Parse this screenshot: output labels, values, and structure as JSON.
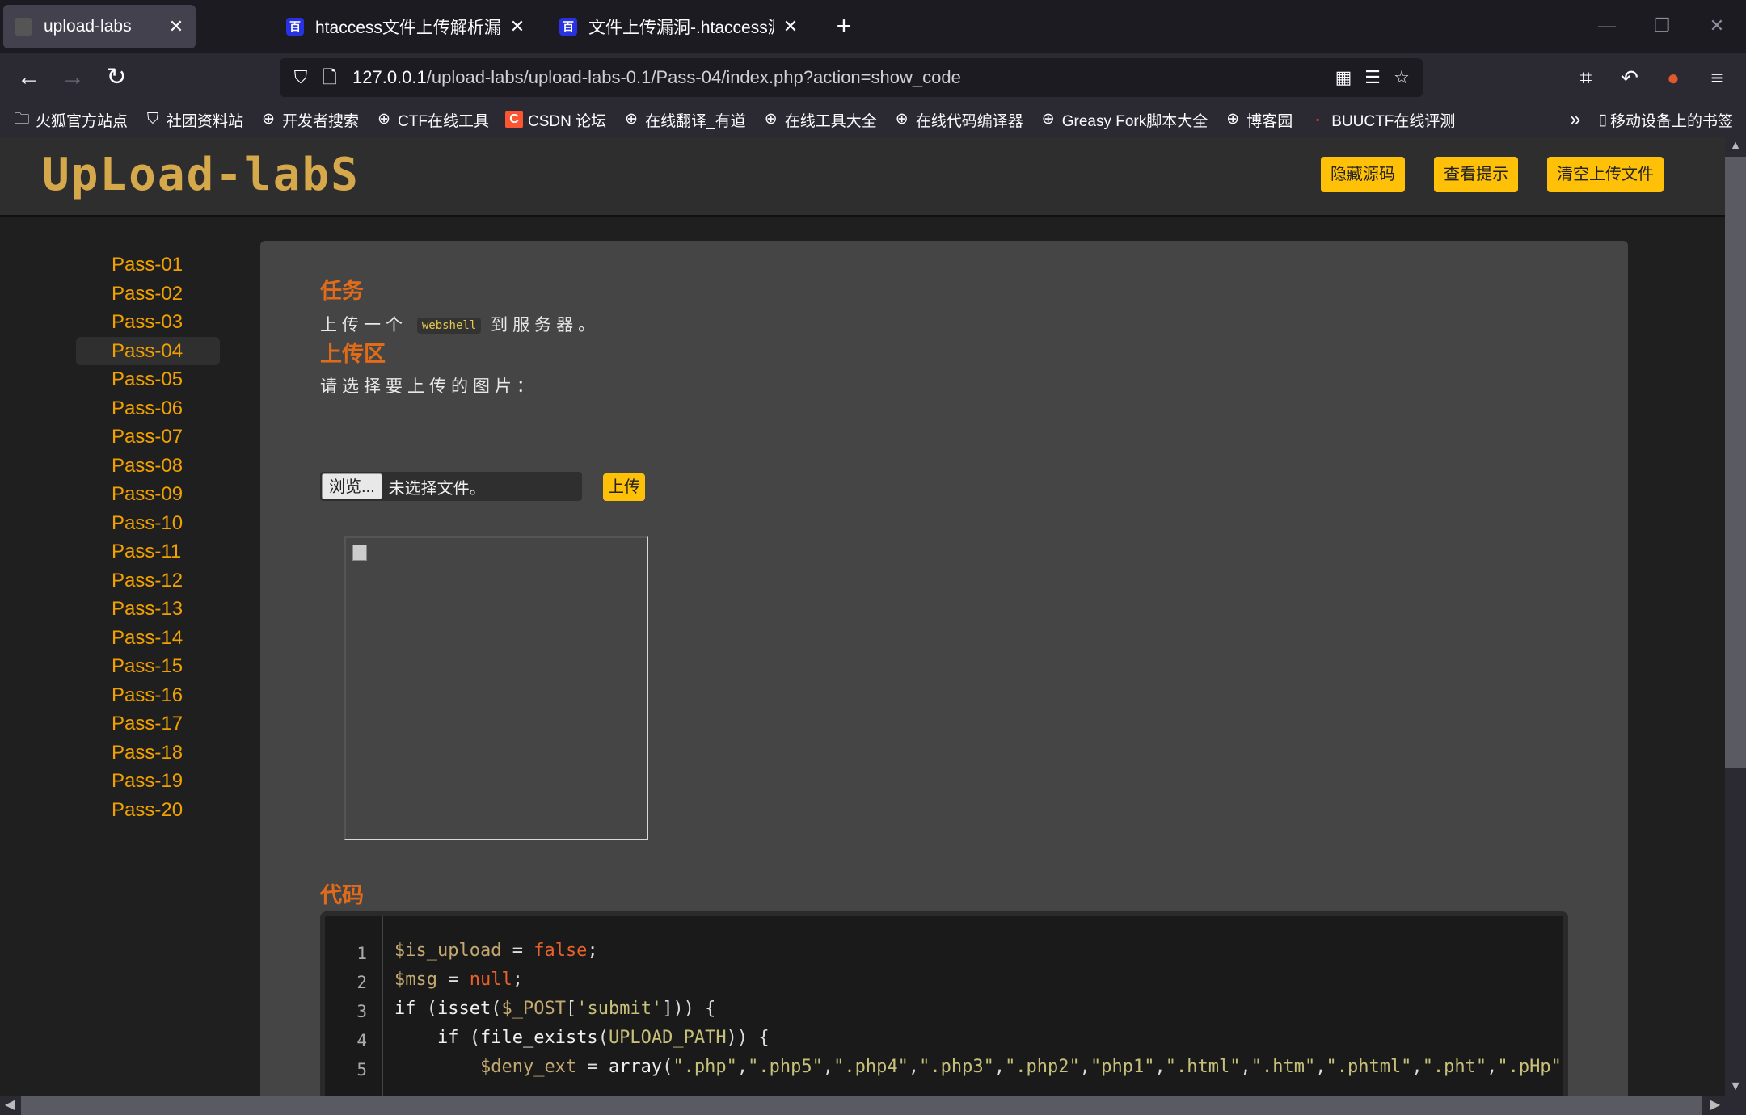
{
  "browser": {
    "tabs": [
      {
        "title": "upload-labs",
        "favicon": "dark-icon"
      },
      {
        "title": "htaccess文件上传解析漏洞_百度",
        "favicon": "baidu-icon"
      },
      {
        "title": "文件上传漏洞-.htaccess漏洞利",
        "favicon": "baidu-icon"
      }
    ],
    "new_tab": "+",
    "url_host": "127.0.0.1",
    "url_rest": "/upload-labs/upload-labs-0.1/Pass-04/index.php?action=show_code",
    "bookmarks": [
      {
        "label": "火狐官方站点",
        "icon": "folder-icon"
      },
      {
        "label": "社团资料站",
        "icon": "shield-icon"
      },
      {
        "label": "开发者搜索",
        "icon": "globe-icon"
      },
      {
        "label": "CTF在线工具",
        "icon": "globe-icon"
      },
      {
        "label": "CSDN 论坛",
        "icon": "csdn-icon"
      },
      {
        "label": "在线翻译_有道",
        "icon": "globe-icon"
      },
      {
        "label": "在线工具大全",
        "icon": "globe-icon"
      },
      {
        "label": "在线代码编译器",
        "icon": "globe-icon"
      },
      {
        "label": "Greasy Fork脚本大全",
        "icon": "globe-icon"
      },
      {
        "label": "博客园",
        "icon": "globe-icon"
      },
      {
        "label": "BUUCTF在线评测",
        "icon": "buu-icon"
      }
    ],
    "mobile_bookmarks": "移动设备上的书签"
  },
  "page": {
    "logo": "UpLoad-labS",
    "header_buttons": [
      "隐藏源码",
      "查看提示",
      "清空上传文件"
    ],
    "sidebar": [
      "Pass-01",
      "Pass-02",
      "Pass-03",
      "Pass-04",
      "Pass-05",
      "Pass-06",
      "Pass-07",
      "Pass-08",
      "Pass-09",
      "Pass-10",
      "Pass-11",
      "Pass-12",
      "Pass-13",
      "Pass-14",
      "Pass-15",
      "Pass-16",
      "Pass-17",
      "Pass-18",
      "Pass-19",
      "Pass-20"
    ],
    "active_pass": "Pass-04",
    "task_title": "任务",
    "task_text_before": "上传一个",
    "task_tag": "webshell",
    "task_text_after": "到服务器。",
    "upload_title": "上传区",
    "upload_prompt": "请选择要上传的图片：",
    "browse_label": "浏览...",
    "no_file": "未选择文件。",
    "upload_button": "上传",
    "code_title": "代码",
    "code_lines": [
      {
        "n": "1",
        "text": "$is_upload = false;"
      },
      {
        "n": "2",
        "text": "$msg = null;"
      },
      {
        "n": "3",
        "text": "if (isset($_POST['submit'])) {"
      },
      {
        "n": "4",
        "text": "    if (file_exists(UPLOAD_PATH)) {"
      },
      {
        "n": "5",
        "text": "        $deny_ext = array(\".php\",\".php5\",\".php4\",\".php3\",\".php2\",\"php1\",\".html\",\".htm\",\".phtml\",\".pht\",\".pHp\""
      }
    ]
  },
  "colors": {
    "accent": "#ffc107",
    "link": "#f0a000",
    "heading": "#e06c1a"
  }
}
